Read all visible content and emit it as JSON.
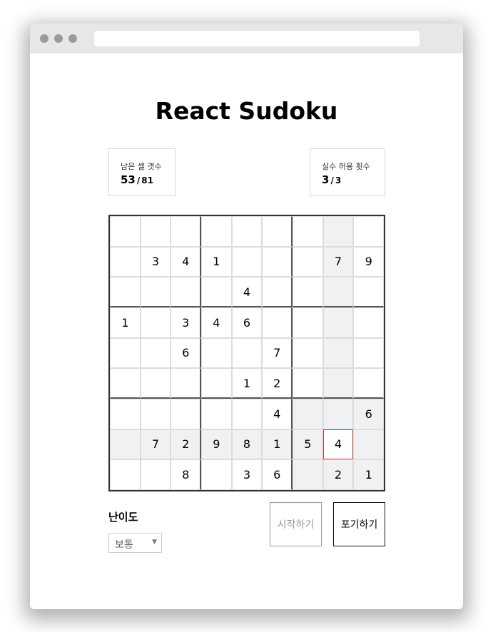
{
  "title": "React Sudoku",
  "stats": {
    "remaining": {
      "label": "남은 셀 갯수",
      "value": "53",
      "total": "81"
    },
    "mistakes": {
      "label": "실수 허용 횟수",
      "value": "3",
      "total": "3"
    }
  },
  "board": {
    "rows": [
      [
        "",
        "",
        "",
        "",
        "",
        "",
        "",
        "",
        ""
      ],
      [
        "",
        "3",
        "4",
        "1",
        "",
        "",
        "",
        "7",
        "9"
      ],
      [
        "",
        "",
        "",
        "",
        "4",
        "",
        "",
        "",
        ""
      ],
      [
        "1",
        "",
        "3",
        "4",
        "6",
        "",
        "",
        "",
        ""
      ],
      [
        "",
        "",
        "6",
        "",
        "",
        "7",
        "",
        "",
        ""
      ],
      [
        "",
        "",
        "",
        "",
        "1",
        "2",
        "",
        "",
        ""
      ],
      [
        "",
        "",
        "",
        "",
        "",
        "4",
        "",
        "",
        "6"
      ],
      [
        "",
        "7",
        "2",
        "9",
        "8",
        "1",
        "5",
        "4",
        ""
      ],
      [
        "",
        "",
        "8",
        "",
        "3",
        "6",
        "",
        "2",
        "1"
      ]
    ],
    "selected": {
      "row": 7,
      "col": 7
    },
    "highlight_color": "#f0f1f3",
    "selected_color": "#dd3333"
  },
  "difficulty": {
    "label": "난이도",
    "selected": "보통"
  },
  "buttons": {
    "start": "시작하기",
    "give_up": "포기하기"
  }
}
